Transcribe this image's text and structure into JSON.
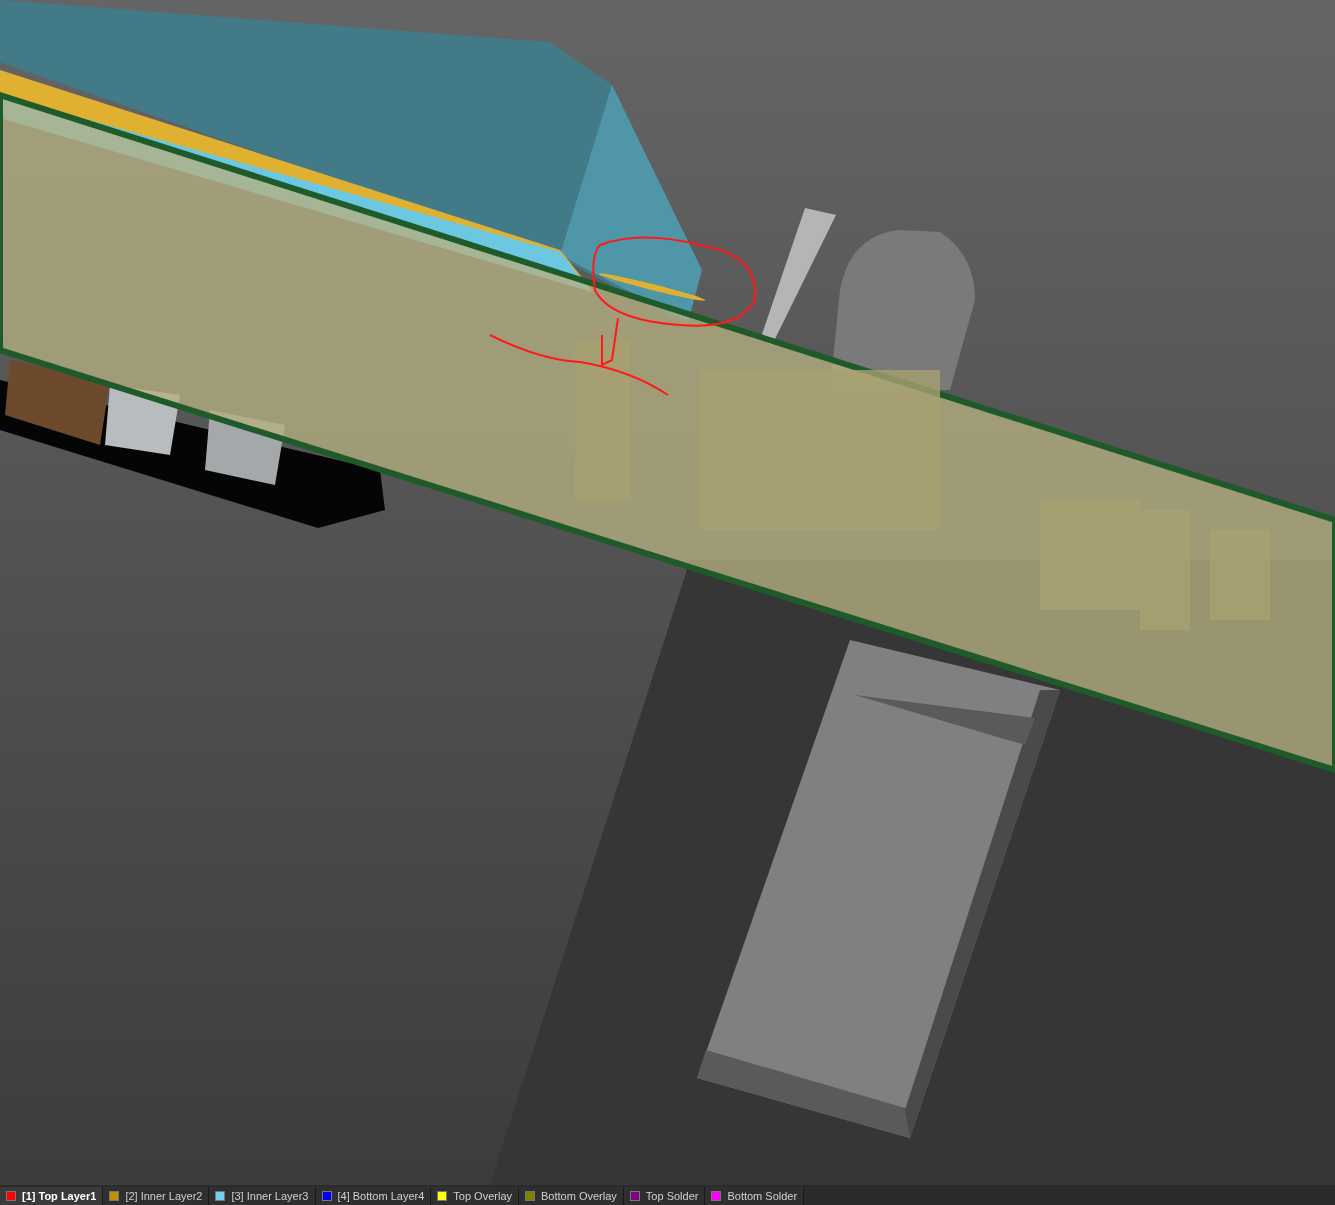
{
  "layer_tabs": [
    {
      "label": "[1] Top Layer1",
      "color": "#ff0000",
      "selected": true
    },
    {
      "label": "[2] Inner Layer2",
      "color": "#c09000",
      "selected": false
    },
    {
      "label": "[3] Inner Layer3",
      "color": "#70d0f0",
      "selected": false
    },
    {
      "label": "[4] Bottom Layer4",
      "color": "#0000ff",
      "selected": false
    },
    {
      "label": "Top Overlay",
      "color": "#ffff00",
      "selected": false
    },
    {
      "label": "Bottom Overlay",
      "color": "#808000",
      "selected": false
    },
    {
      "label": "Top Solder",
      "color": "#800080",
      "selected": false
    },
    {
      "label": "Bottom Solder",
      "color": "#ff00ff",
      "selected": false
    }
  ]
}
